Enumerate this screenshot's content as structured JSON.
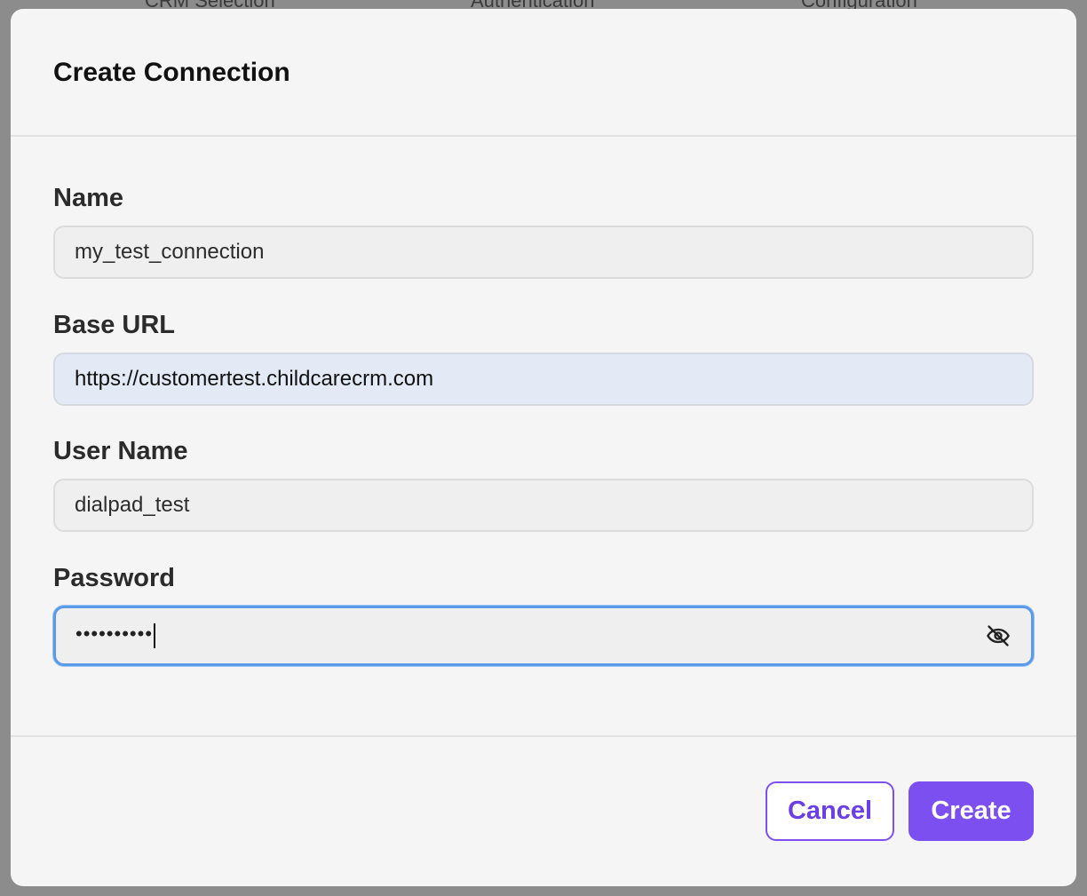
{
  "backdrop": {
    "steps": [
      "CRM Selection",
      "Authentication",
      "Configuration"
    ]
  },
  "modal": {
    "title": "Create Connection",
    "fields": {
      "name": {
        "label": "Name",
        "value": "my_test_connection"
      },
      "base_url": {
        "label": "Base URL",
        "value": "https://customertest.childcarecrm.com"
      },
      "user_name": {
        "label": "User Name",
        "value": "dialpad_test"
      },
      "password": {
        "label": "Password",
        "masked_value": "••••••••••",
        "toggle_icon": "eye-off-icon"
      }
    },
    "footer": {
      "cancel_label": "Cancel",
      "create_label": "Create"
    }
  },
  "colors": {
    "accent": "#7b4ff0",
    "focus_ring": "#5b9ae6",
    "autofill_bg": "#e3e9f5"
  }
}
